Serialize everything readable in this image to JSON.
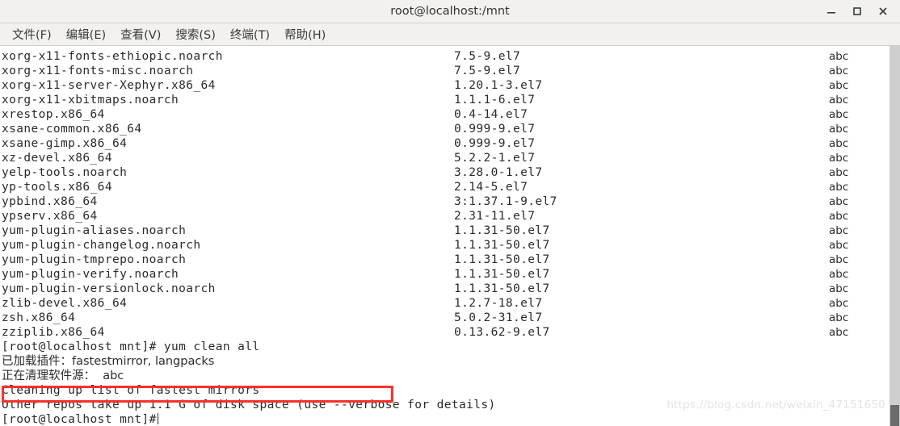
{
  "window": {
    "title": "root@localhost:/mnt",
    "controls": [
      {
        "name": "minimize-button",
        "label": "–"
      },
      {
        "name": "maximize-button",
        "label": "□"
      },
      {
        "name": "close-button",
        "label": "✕"
      }
    ]
  },
  "menubar": {
    "items": [
      {
        "label": "文件(F)"
      },
      {
        "label": "编辑(E)"
      },
      {
        "label": "查看(V)"
      },
      {
        "label": "搜索(S)"
      },
      {
        "label": "终端(T)"
      },
      {
        "label": "帮助(H)"
      }
    ]
  },
  "terminal": {
    "packages": [
      {
        "name": "xorg-x11-fonts-ethiopic.noarch",
        "version": "7.5-9.el7",
        "repo": "abc"
      },
      {
        "name": "xorg-x11-fonts-misc.noarch",
        "version": "7.5-9.el7",
        "repo": "abc"
      },
      {
        "name": "xorg-x11-server-Xephyr.x86_64",
        "version": "1.20.1-3.el7",
        "repo": "abc"
      },
      {
        "name": "xorg-x11-xbitmaps.noarch",
        "version": "1.1.1-6.el7",
        "repo": "abc"
      },
      {
        "name": "xrestop.x86_64",
        "version": "0.4-14.el7",
        "repo": "abc"
      },
      {
        "name": "xsane-common.x86_64",
        "version": "0.999-9.el7",
        "repo": "abc"
      },
      {
        "name": "xsane-gimp.x86_64",
        "version": "0.999-9.el7",
        "repo": "abc"
      },
      {
        "name": "xz-devel.x86_64",
        "version": "5.2.2-1.el7",
        "repo": "abc"
      },
      {
        "name": "yelp-tools.noarch",
        "version": "3.28.0-1.el7",
        "repo": "abc"
      },
      {
        "name": "yp-tools.x86_64",
        "version": "2.14-5.el7",
        "repo": "abc"
      },
      {
        "name": "ypbind.x86_64",
        "version": "3:1.37.1-9.el7",
        "repo": "abc"
      },
      {
        "name": "ypserv.x86_64",
        "version": "2.31-11.el7",
        "repo": "abc"
      },
      {
        "name": "yum-plugin-aliases.noarch",
        "version": "1.1.31-50.el7",
        "repo": "abc"
      },
      {
        "name": "yum-plugin-changelog.noarch",
        "version": "1.1.31-50.el7",
        "repo": "abc"
      },
      {
        "name": "yum-plugin-tmprepo.noarch",
        "version": "1.1.31-50.el7",
        "repo": "abc"
      },
      {
        "name": "yum-plugin-verify.noarch",
        "version": "1.1.31-50.el7",
        "repo": "abc"
      },
      {
        "name": "yum-plugin-versionlock.noarch",
        "version": "1.1.31-50.el7",
        "repo": "abc"
      },
      {
        "name": "zlib-devel.x86_64",
        "version": "1.2.7-18.el7",
        "repo": "abc"
      },
      {
        "name": "zsh.x86_64",
        "version": "5.0.2-31.el7",
        "repo": "abc"
      },
      {
        "name": "zziplib.x86_64",
        "version": "0.13.62-9.el7",
        "repo": "abc"
      }
    ],
    "command_line": "[root@localhost mnt]# yum clean all",
    "output_lines": [
      {
        "text": "已加载插件：fastestmirror, langpacks",
        "cjk": true
      },
      {
        "text": "正在清理软件源：  abc",
        "cjk": true
      },
      {
        "text": "Cleaning up list of fastest mirrors",
        "cjk": false
      },
      {
        "text": "Other repos take up 1.1 G of disk space (use --verbose for details)",
        "cjk": false
      }
    ],
    "final_prompt": "[root@localhost mnt]#"
  },
  "annotation": {
    "highlight_color": "#f9322c"
  },
  "watermark": {
    "text": "https://blog.csdn.net/weixin_47151650"
  }
}
